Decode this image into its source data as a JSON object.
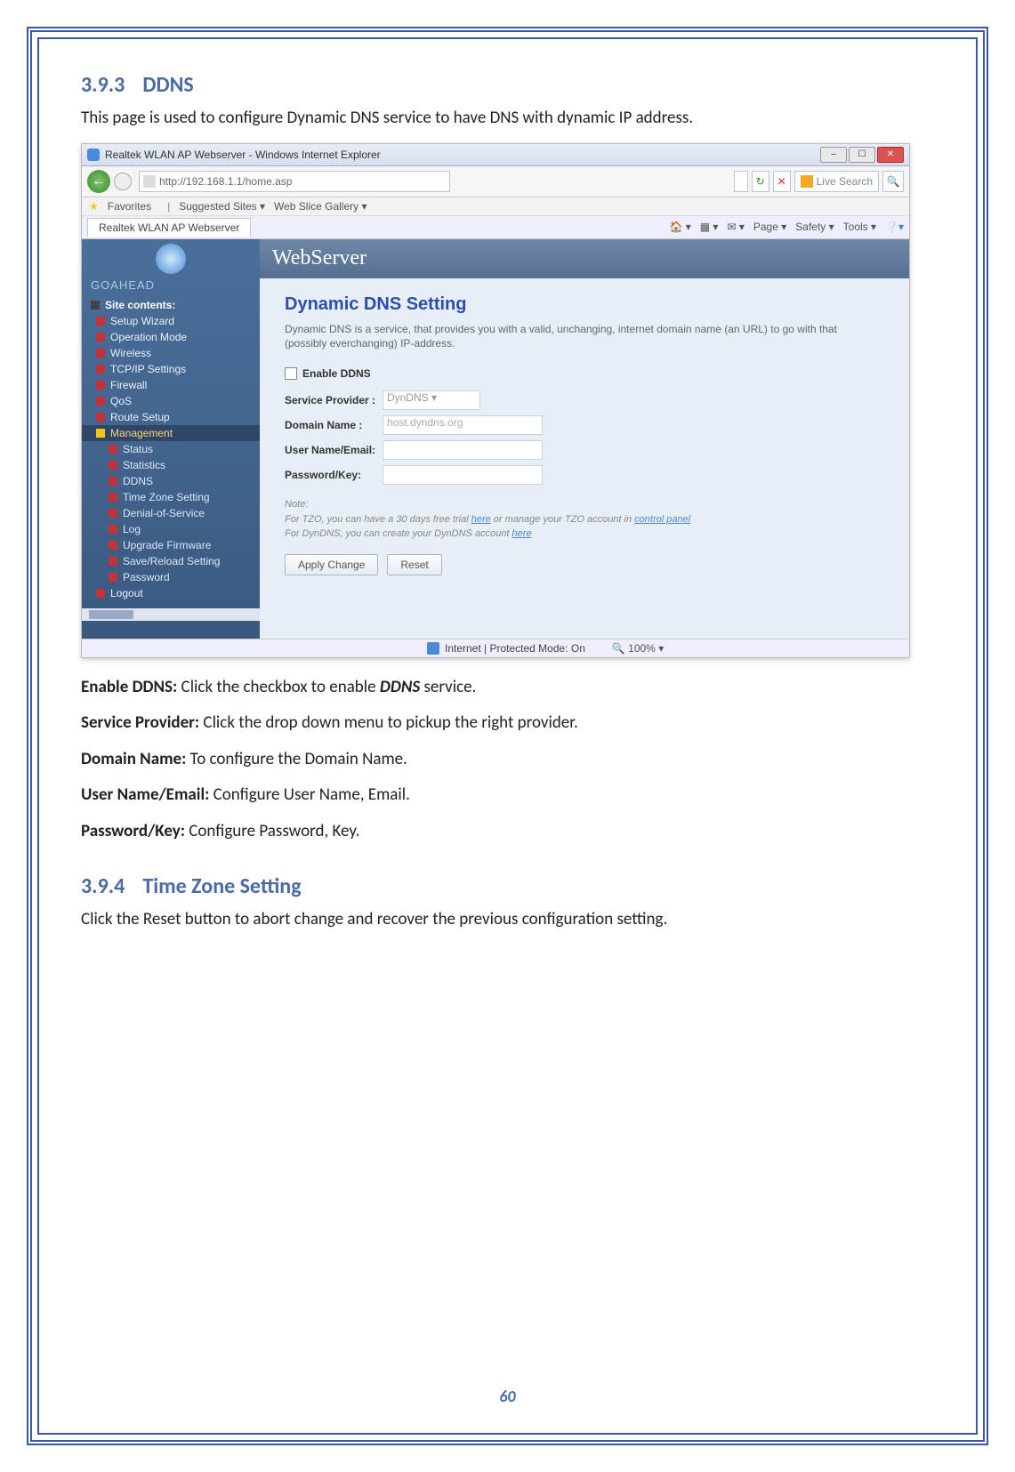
{
  "section1": {
    "num": "3.9.3",
    "title": "DDNS"
  },
  "intro1": "This page is used to configure Dynamic DNS service to have DNS with dynamic IP address.",
  "ie": {
    "title": "Realtek WLAN AP Webserver - Windows Internet Explorer",
    "url": "http://192.168.1.1/home.asp",
    "search_engine": "Live Search",
    "favorites_label": "Favorites",
    "suggested": "Suggested Sites ▾",
    "webslice": "Web Slice Gallery ▾",
    "tab": "Realtek WLAN AP Webserver",
    "cmd_page": "Page ▾",
    "cmd_safety": "Safety ▾",
    "cmd_tools": "Tools ▾",
    "status_zone": "Internet | Protected Mode: On",
    "status_zoom": "100%"
  },
  "ws": {
    "banner": "WebServer",
    "brand": "GOAHEAD",
    "nav": {
      "site": "Site contents:",
      "setup": "Setup Wizard",
      "op": "Operation Mode",
      "wireless": "Wireless",
      "tcpip": "TCP/IP Settings",
      "firewall": "Firewall",
      "qos": "QoS",
      "route": "Route Setup",
      "mgmt": "Management",
      "status": "Status",
      "stats": "Statistics",
      "ddns": "DDNS",
      "tz": "Time Zone Setting",
      "dos": "Denial-of-Service",
      "log": "Log",
      "upg": "Upgrade Firmware",
      "save": "Save/Reload Setting",
      "pwd": "Password",
      "logout": "Logout"
    },
    "page_title": "Dynamic DNS  Setting",
    "page_desc": "Dynamic DNS is a service, that provides you with a valid, unchanging, internet domain name (an URL) to go with that (possibly everchanging) IP-address.",
    "enable_label": "Enable DDNS",
    "sp_label": "Service Provider :",
    "sp_value": "DynDNS ▾",
    "dn_label": "Domain Name :",
    "dn_value": "host.dyndns.org",
    "un_label": "User Name/Email:",
    "pw_label": "Password/Key:",
    "note_head": "Note:",
    "note_l1a": "For TZO, you can have a 30 days free trial ",
    "note_here": "here",
    "note_l1b": " or manage your TZO account in ",
    "note_cp": "control panel",
    "note_l2a": "For DynDNS, you can create your DynDNS account ",
    "btn_apply": "Apply Change",
    "btn_reset": "Reset"
  },
  "desc": {
    "enable_l": "Enable DDNS:",
    "enable_t": " Click the checkbox to enable ",
    "enable_em": "DDNS",
    "enable_t2": " service.",
    "sp_l": "Service Provider:",
    "sp_t": " Click the drop down menu to pickup the right provider.",
    "dn_l": "Domain Name:",
    "dn_t": " To configure the Domain Name.",
    "un_l": "User Name/Email:",
    "un_t": " Configure User Name, Email.",
    "pw_l": "Password/Key:",
    "pw_t": " Configure Password, Key."
  },
  "section2": {
    "num": "3.9.4",
    "title": "Time Zone Setting"
  },
  "intro2": "Click the Reset button to abort change and recover the previous configuration setting.",
  "page_number": "60"
}
